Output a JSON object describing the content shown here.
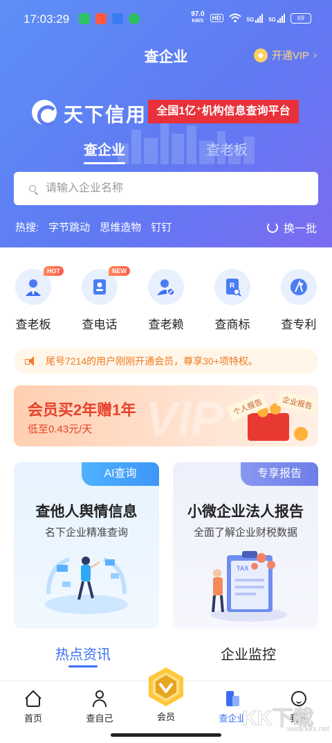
{
  "status_bar": {
    "time": "17:03:29",
    "speed": "97.0",
    "speed_unit": "KB/S",
    "hd": "HD",
    "net1": "5G",
    "net2": "5G",
    "battery": "69"
  },
  "header": {
    "title": "查企业",
    "vip_link": "开通VIP"
  },
  "brand": {
    "name": "天下信用",
    "banner": "全国1亿⁺机构信息查询平台"
  },
  "search_tabs": [
    "查企业",
    "查老板"
  ],
  "search": {
    "placeholder": "请输入企业名称"
  },
  "hot_search": {
    "label": "热搜:",
    "items": [
      "字节跳动",
      "思维造物",
      "钉钉"
    ],
    "refresh_label": "换一批"
  },
  "features": [
    {
      "label": "查老板",
      "badge": "HOT",
      "icon": "boss-icon"
    },
    {
      "label": "查电话",
      "badge": "NEW",
      "icon": "phone-book-icon"
    },
    {
      "label": "查老赖",
      "badge": "",
      "icon": "defaulter-icon"
    },
    {
      "label": "查商标",
      "badge": "",
      "icon": "trademark-icon"
    },
    {
      "label": "查专利",
      "badge": "",
      "icon": "patent-icon"
    }
  ],
  "notice": {
    "text": "尾号7214的用户刚刚开通会员，尊享30+项特权。"
  },
  "promo": {
    "title": "会员买2年赠1年",
    "subtitle": "低至0.43元/天",
    "bg_text": "VIP",
    "tag1": "个人报告",
    "tag2": "企业报告"
  },
  "service_cards": [
    {
      "tag": "AI查询",
      "title": "查他人舆情信息",
      "subtitle": "名下企业精准查询"
    },
    {
      "tag": "专享报告",
      "title": "小微企业法人报告",
      "subtitle": "全面了解企业财税数据",
      "illus_text": "TAX"
    }
  ],
  "content_tabs": [
    "热点资讯",
    "企业监控"
  ],
  "tabbar": [
    {
      "label": "首页",
      "icon": "home-icon"
    },
    {
      "label": "查自己",
      "icon": "person-icon"
    },
    {
      "label": "会员",
      "icon": "member-badge-icon"
    },
    {
      "label": "查企业",
      "icon": "building-icon"
    },
    {
      "label": "我的",
      "icon": "face-icon"
    }
  ],
  "watermark": {
    "text": "www.kkx.net",
    "logo": "KK下载"
  },
  "colors": {
    "accent": "#3a6ef2",
    "hero_start": "#5e8ff6",
    "hero_end": "#7a6cf1",
    "banner_red": "#e8313a",
    "notice_orange": "#f07a22",
    "promo_red": "#e8402b"
  }
}
